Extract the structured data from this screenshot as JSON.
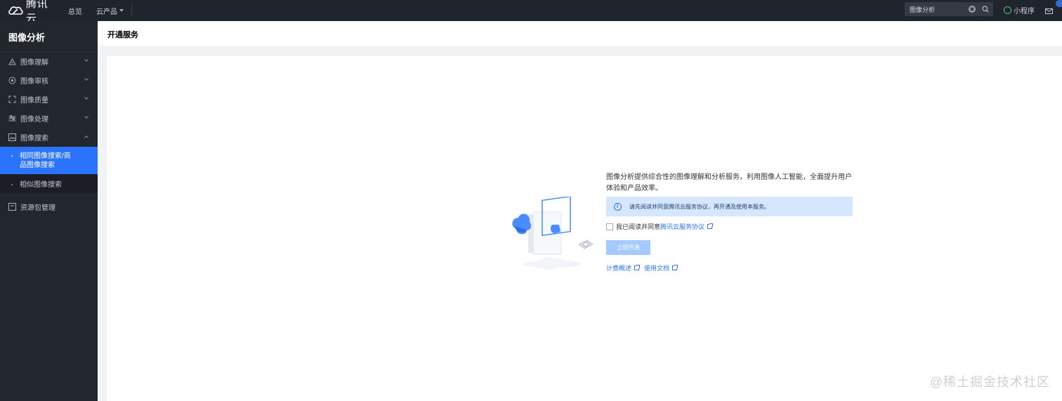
{
  "topbar": {
    "brand": "腾讯云",
    "nav_overview": "总览",
    "nav_products": "云产品",
    "search_value": "图像分析",
    "mini_program": "小程序",
    "brand_color": "#20242c"
  },
  "sidebar": {
    "title": "图像分析",
    "items": [
      {
        "label": "图像理解",
        "icon": "triangle-nodes-icon"
      },
      {
        "label": "图像审核",
        "icon": "target-icon"
      },
      {
        "label": "图像质量",
        "icon": "focus-frame-icon"
      },
      {
        "label": "图像处理",
        "icon": "sliders-icon"
      },
      {
        "label": "图像搜索",
        "icon": "image-icon"
      }
    ],
    "sub_items": [
      {
        "label": "相同图像搜索/商品图像搜索",
        "active": true
      },
      {
        "label": "相似图像搜索",
        "active": false
      }
    ],
    "package": {
      "label": "资源包管理",
      "icon": "package-icon"
    },
    "active_color": "#2a73ff"
  },
  "page": {
    "title": "开通服务"
  },
  "service": {
    "intro": "图像分析提供综合性的图像理解和分析服务，利用图像人工智能，全面提升用户体验和产品效率。",
    "notice": "请先阅读并同意腾讯云服务协议，再开通及使用本服务。",
    "agree_prefix": "我已阅读并同意",
    "agree_link": "腾讯云服务协议",
    "activate_button": "立即开通",
    "link_billing": "计费概述",
    "link_docs": "使用文档"
  },
  "watermark": "@稀土掘金技术社区"
}
